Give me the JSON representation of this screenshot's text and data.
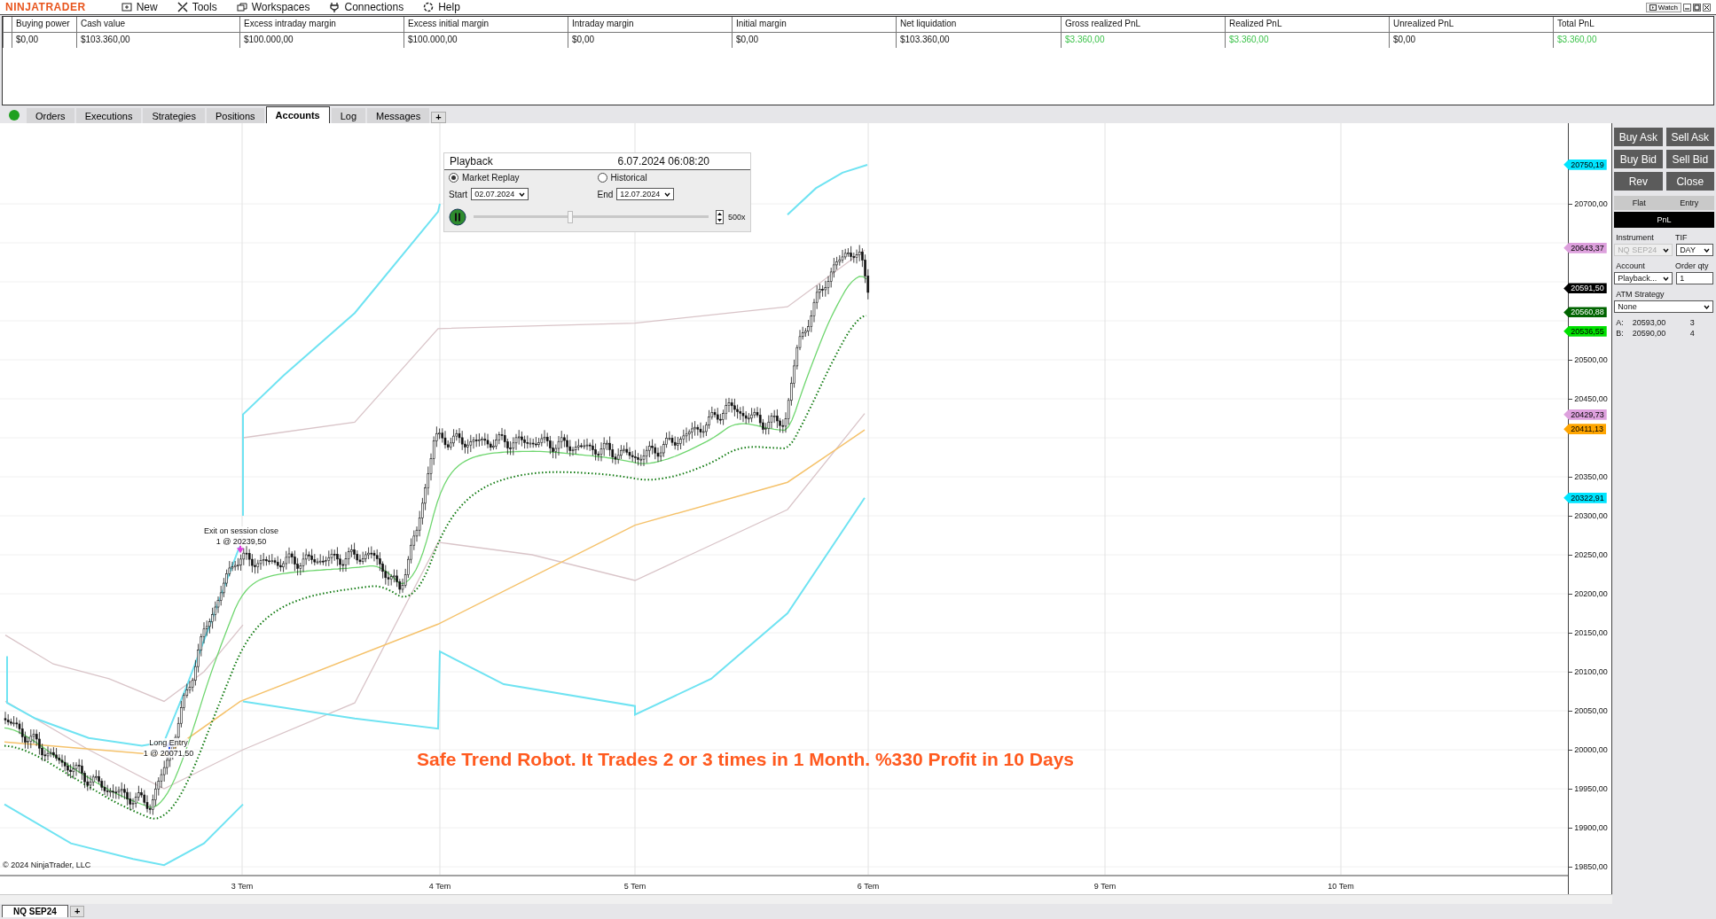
{
  "menu": {
    "logo": "NINJATRADER",
    "items": [
      "New",
      "Tools",
      "Workspaces",
      "Connections",
      "Help"
    ],
    "watch": "Watch"
  },
  "accounts": {
    "columns": [
      {
        "header": "Buying power",
        "value": "$0,00",
        "gain": false
      },
      {
        "header": "Cash value",
        "value": "$103.360,00",
        "gain": false
      },
      {
        "header": "Excess intraday margin",
        "value": "$100.000,00",
        "gain": false
      },
      {
        "header": "Excess initial margin",
        "value": "$100.000,00",
        "gain": false
      },
      {
        "header": "Intraday margin",
        "value": "$0,00",
        "gain": false
      },
      {
        "header": "Initial margin",
        "value": "$0,00",
        "gain": false
      },
      {
        "header": "Net liquidation",
        "value": "$103.360,00",
        "gain": false
      },
      {
        "header": "Gross realized PnL",
        "value": "$3.360,00",
        "gain": true
      },
      {
        "header": "Realized PnL",
        "value": "$3.360,00",
        "gain": true
      },
      {
        "header": "Unrealized PnL",
        "value": "$0,00",
        "gain": false
      },
      {
        "header": "Total PnL",
        "value": "$3.360,00",
        "gain": true
      }
    ]
  },
  "tabs": [
    {
      "label": "Orders",
      "selected": false
    },
    {
      "label": "Executions",
      "selected": false
    },
    {
      "label": "Strategies",
      "selected": false
    },
    {
      "label": "Positions",
      "selected": false
    },
    {
      "label": "Accounts",
      "selected": true
    },
    {
      "label": "Log",
      "selected": false
    },
    {
      "label": "Messages",
      "selected": false
    }
  ],
  "tab_add": "+",
  "playback": {
    "title": "Playback",
    "time": "6.07.2024 06:08:20",
    "modes": [
      {
        "label": "Market Replay",
        "selected": true
      },
      {
        "label": "Historical",
        "selected": false
      }
    ],
    "start_label": "Start",
    "start": "02.07.2024",
    "end_label": "End",
    "end": "12.07.2024",
    "level": 0.41,
    "speed": "500x"
  },
  "chart": {
    "price_labels": [
      "20700,00",
      "20500,00",
      "20450,00",
      "20350,00",
      "20300,00",
      "20250,00",
      "20200,00",
      "20150,00",
      "20100,00",
      "20050,00",
      "20000,00",
      "19950,00",
      "19900,00",
      "19850,00"
    ],
    "price_tags": [
      {
        "text": "20750,19",
        "color": "#00e5ff"
      },
      {
        "text": "20643,37",
        "color": "#dda0dd"
      },
      {
        "text": "20591,50",
        "color": "#000000"
      },
      {
        "text": "20560,88",
        "color": "#006400"
      },
      {
        "text": "20536,55",
        "color": "#00e000"
      },
      {
        "text": "20429,73",
        "color": "#dda0dd"
      },
      {
        "text": "20411,13",
        "color": "#ffa500"
      },
      {
        "text": "20322,91",
        "color": "#00e5ff"
      }
    ],
    "time_labels": [
      "3 Tem",
      "4 Tem",
      "5 Tem",
      "6 Tem",
      "9 Tem",
      "10 Tem"
    ],
    "exit_label": "Exit on session close",
    "exit_fill": "1 @ 20239,50",
    "entry_label": "Long Entry",
    "entry_fill": "1 @ 20071,50",
    "caption": "Safe Trend Robot. It Trades 2 or 3 times in 1 Month. %330 Profit in 10 Days",
    "copyright": "© 2024 NinjaTrader, LLC"
  },
  "order_panel": {
    "buttons": [
      "Buy Ask",
      "Sell Ask",
      "Buy Bid",
      "Sell Bid",
      "Rev",
      "Close"
    ],
    "position": [
      "Flat",
      "Entry"
    ],
    "pnl": "PnL",
    "instrument_label": "Instrument",
    "instrument": "NQ SEP24",
    "tif_label": "TIF",
    "tif": "DAY",
    "account_label": "Account",
    "account": "Playback...",
    "qty_label": "Order qty",
    "qty": "1",
    "atm_label": "ATM Strategy",
    "atm": "None",
    "ask": [
      "A:",
      "20593,00",
      "3"
    ],
    "bid": [
      "B:",
      "20590,00",
      "4"
    ]
  },
  "bottom_tabs": [
    {
      "label": "NQ SEP24",
      "selected": true
    }
  ],
  "bottom_add": "+"
}
